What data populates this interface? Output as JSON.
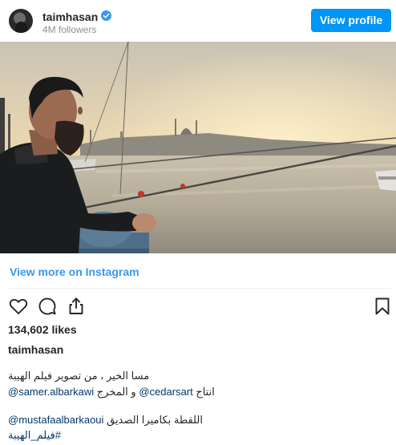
{
  "header": {
    "username": "taimhasan",
    "followers": "4M followers",
    "view_profile_label": "View profile"
  },
  "post": {
    "view_more_label": "View more on Instagram",
    "likes": "134,602 likes",
    "caption_username": "taimhasan",
    "caption_lines": {
      "line1": "مسا الخير ، من تصوير فيلم الهيبة",
      "line2_mention1": "@samer.albarkawi",
      "line2_middle": " و المخرج ",
      "line2_mention2": "@cedarsart",
      "line2_end": " انتاج",
      "line4_mention": "@mustafaalbarkaoui",
      "line4_text": " اللقطة بكاميرا الصديق",
      "line5": "#فيلم_الهيبة"
    }
  },
  "colors": {
    "accent": "#0095f6",
    "link": "#3897f0",
    "text": "#262626",
    "muted": "#8e8e8e"
  },
  "icons": [
    "verified-badge-icon",
    "heart-icon",
    "comment-icon",
    "share-icon",
    "bookmark-icon"
  ]
}
